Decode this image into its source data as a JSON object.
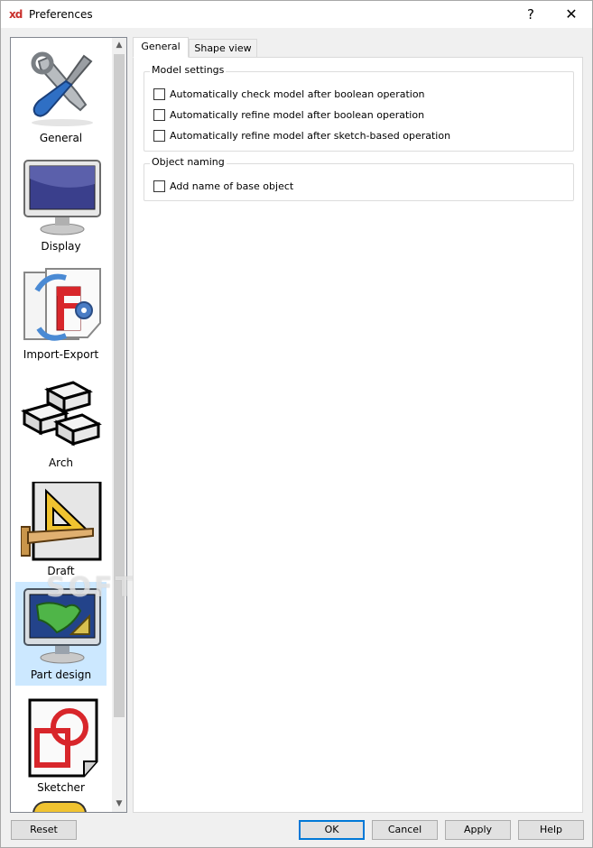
{
  "window": {
    "title": "Preferences",
    "app_icon_text": "xd",
    "help_glyph": "?",
    "close_glyph": "✕"
  },
  "sidebar": {
    "items": [
      {
        "label": "General",
        "icon": "wrench-screwdriver-icon"
      },
      {
        "label": "Display",
        "icon": "monitor-icon"
      },
      {
        "label": "Import-Export",
        "icon": "import-export-icon"
      },
      {
        "label": "Arch",
        "icon": "bricks-icon"
      },
      {
        "label": "Draft",
        "icon": "set-square-icon"
      },
      {
        "label": "Part design",
        "icon": "part-design-icon",
        "selected": true
      },
      {
        "label": "Sketcher",
        "icon": "sketcher-icon"
      }
    ]
  },
  "tabs": [
    {
      "label": "General",
      "active": true
    },
    {
      "label": "Shape view",
      "active": false
    }
  ],
  "groups": {
    "model_settings": {
      "title": "Model settings",
      "options": [
        {
          "label": "Automatically check model after boolean operation",
          "checked": false
        },
        {
          "label": "Automatically refine model after boolean operation",
          "checked": false
        },
        {
          "label": "Automatically refine model after sketch-based operation",
          "checked": false
        }
      ]
    },
    "object_naming": {
      "title": "Object naming",
      "options": [
        {
          "label": "Add name of base object",
          "checked": false
        }
      ]
    }
  },
  "watermark": "SOFTPEDIA",
  "buttons": {
    "reset": "Reset",
    "ok": "OK",
    "cancel": "Cancel",
    "apply": "Apply",
    "help": "Help"
  },
  "colors": {
    "selection": "#cce8ff",
    "ok_border": "#0078d7"
  }
}
